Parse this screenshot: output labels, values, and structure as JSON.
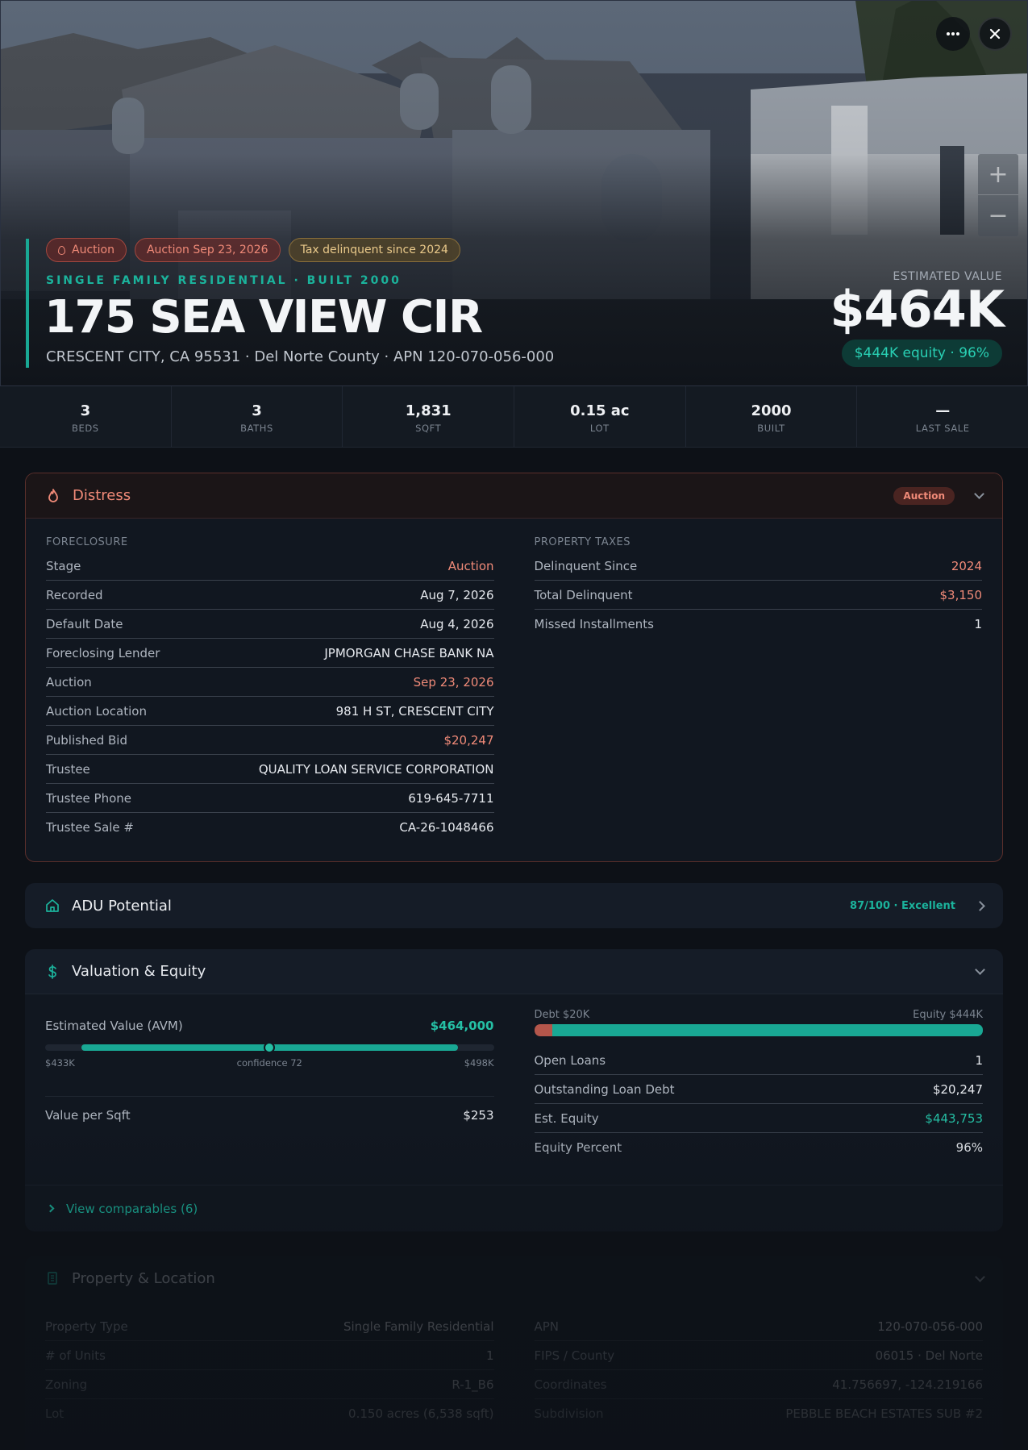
{
  "hero": {
    "badges": [
      {
        "label": "Auction"
      },
      {
        "label": "Auction Sep 23, 2026"
      },
      {
        "label": "Tax delinquent since 2024"
      }
    ],
    "subtype": "SINGLE FAMILY RESIDENTIAL · BUILT 2000",
    "address": "175 SEA VIEW CIR",
    "location": "CRESCENT CITY, CA 95531 · Del Norte County · APN 120-070-056-000",
    "estimated_label": "ESTIMATED VALUE",
    "estimated_value": "$464K",
    "equity_pill": "$444K equity · 96%",
    "zoom_in": "+",
    "zoom_out": "−",
    "accent_color": "#19a894"
  },
  "stats": [
    {
      "value": "3",
      "label": "BEDS"
    },
    {
      "value": "3",
      "label": "BATHS"
    },
    {
      "value": "1,831",
      "label": "SQFT"
    },
    {
      "value": "0.15 ac",
      "label": "LOT"
    },
    {
      "value": "2000",
      "label": "BUILT"
    },
    {
      "value": "—",
      "label": "LAST SALE"
    }
  ],
  "distress": {
    "title": "Distress",
    "badge": "Auction",
    "foreclosure_label": "FORECLOSURE",
    "foreclosure": [
      {
        "k": "Stage",
        "v": "Auction"
      },
      {
        "k": "Recorded",
        "v": "Aug 7, 2026"
      },
      {
        "k": "Default Date",
        "v": "Aug 4, 2026"
      },
      {
        "k": "Foreclosing Lender",
        "v": "JPMORGAN CHASE BANK NA"
      },
      {
        "k": "Auction",
        "v": "Sep 23, 2026"
      },
      {
        "k": "Auction Location",
        "v": "981 H ST, CRESCENT CITY"
      },
      {
        "k": "Published Bid",
        "v": "$20,247"
      },
      {
        "k": "Trustee",
        "v": "QUALITY LOAN SERVICE CORPORATION"
      },
      {
        "k": "Trustee Phone",
        "v": "619-645-7711"
      },
      {
        "k": "Trustee Sale #",
        "v": "CA-26-1048466"
      }
    ],
    "taxes_label": "PROPERTY TAXES",
    "taxes": [
      {
        "k": "Delinquent Since",
        "v": "2024"
      },
      {
        "k": "Total Delinquent",
        "v": "$3,150"
      },
      {
        "k": "Missed Installments",
        "v": "1"
      }
    ],
    "highlight_color": "#f08a78"
  },
  "adu": {
    "title": "ADU Potential",
    "score": "87/100 · Excellent"
  },
  "valuation": {
    "title": "Valuation & Equity",
    "avm_label": "Estimated Value (AVM)",
    "avm_value": "$464,000",
    "range_low": "$433K",
    "range_mid": "confidence 72",
    "range_high": "$498K",
    "confidence": 0.72,
    "vps_label": "Value per Sqft",
    "vps_value": "$253",
    "debt_label": "Debt $20K",
    "equity_label": "Equity $444K",
    "debt_fraction": 0.04,
    "rows": [
      {
        "k": "Open Loans",
        "v": "1"
      },
      {
        "k": "Outstanding Loan Debt",
        "v": "$20,247"
      },
      {
        "k": "Est. Equity",
        "v": "$443,753"
      },
      {
        "k": "Equity Percent",
        "v": "96%"
      }
    ],
    "comps": "View comparables (6)"
  },
  "property": {
    "title": "Property & Location",
    "left": [
      {
        "k": "Property Type",
        "v": "Single Family Residential"
      },
      {
        "k": "# of Units",
        "v": "1"
      },
      {
        "k": "Zoning",
        "v": "R-1_B6"
      },
      {
        "k": "Lot",
        "v": "0.150 acres (6,538 sqft)"
      }
    ],
    "right": [
      {
        "k": "APN",
        "v": "120-070-056-000"
      },
      {
        "k": "FIPS / County",
        "v": "06015 · Del Norte"
      },
      {
        "k": "Coordinates",
        "v": "41.756697, -124.219166"
      },
      {
        "k": "Subdivision",
        "v": "PEBBLE BEACH ESTATES SUB #2"
      }
    ]
  }
}
